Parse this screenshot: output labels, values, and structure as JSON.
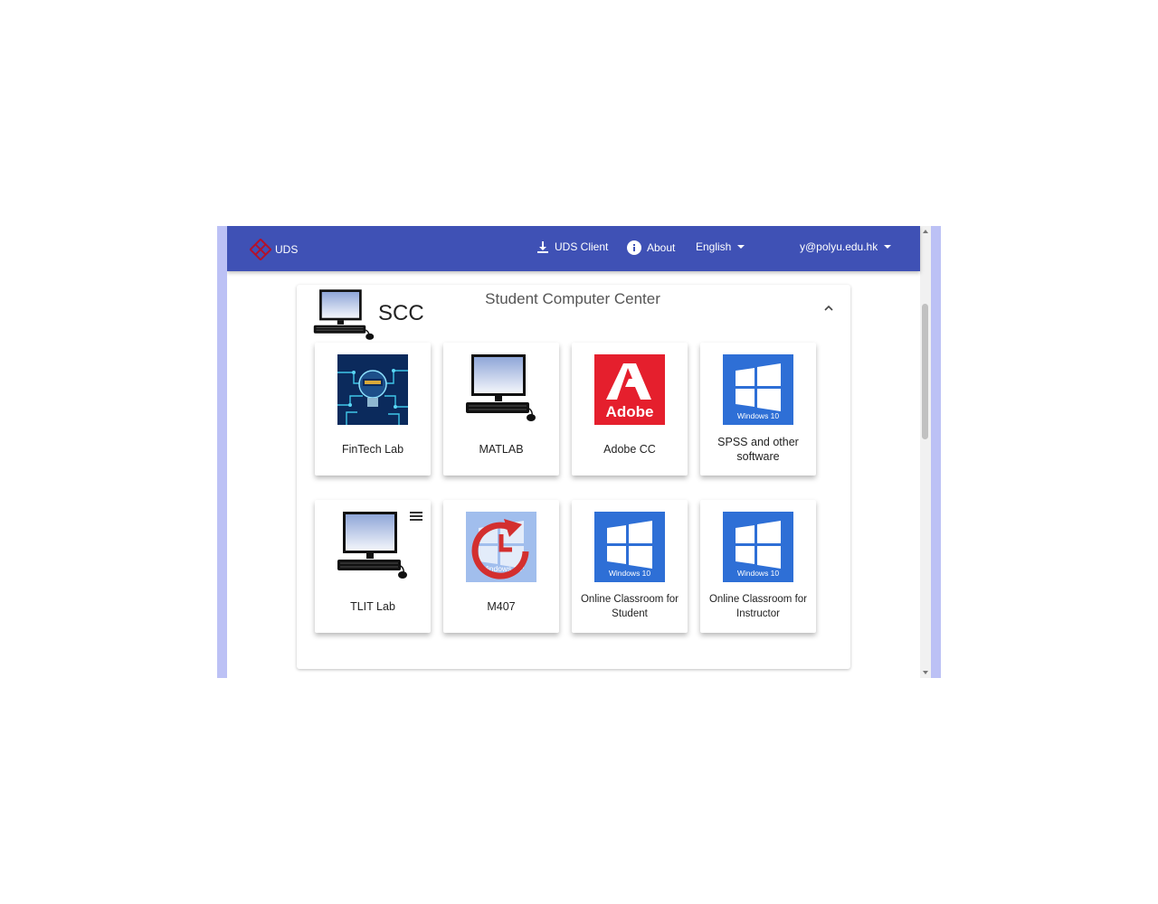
{
  "header": {
    "brand_label": "UDS",
    "client_label": "UDS Client",
    "about_label": "About",
    "language_label": "English",
    "user_label": "y@polyu.edu.hk"
  },
  "group": {
    "short_name": "SCC",
    "title": "Student Computer Center"
  },
  "services": [
    {
      "label": "FinTech Lab",
      "icon": "fintech-image"
    },
    {
      "label": "MATLAB",
      "icon": "computer-icon"
    },
    {
      "label": "Adobe CC",
      "icon": "adobe-logo",
      "logo_text": "Adobe"
    },
    {
      "label": "SPSS and other software",
      "icon": "windows10-logo",
      "logo_text": "Windows 10"
    },
    {
      "label": "TLIT Lab",
      "icon": "computer-icon"
    },
    {
      "label": "M407",
      "icon": "windows10-logo",
      "logo_text": "Windows 10",
      "overlay": "refresh-icon"
    },
    {
      "label": "Online Classroom for Student",
      "icon": "windows10-logo",
      "logo_text": "Windows 10"
    },
    {
      "label": "Online Classroom for Instructor",
      "icon": "windows10-logo",
      "logo_text": "Windows 10"
    }
  ],
  "colors": {
    "header": "#3f51b5",
    "frame": "#bcc1f5",
    "adobe": "#e51f2d",
    "windows": "#2e6fd6",
    "refresh": "#d32f2f"
  }
}
